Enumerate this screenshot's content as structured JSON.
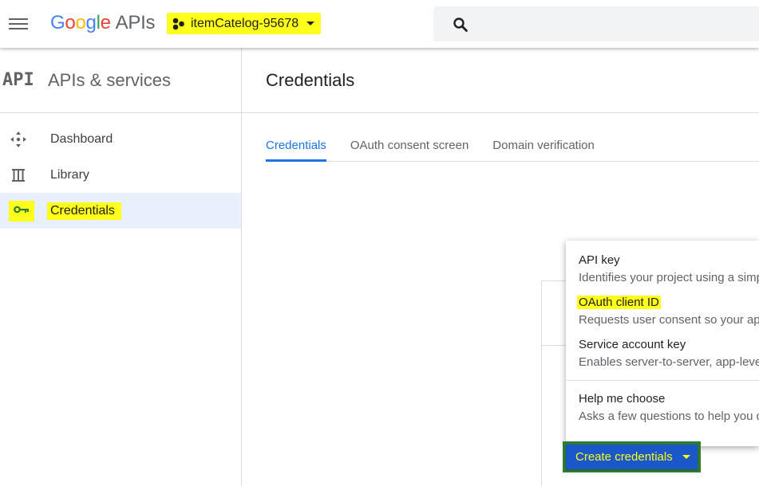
{
  "header": {
    "logo": {
      "G": "G",
      "o1": "o",
      "o2": "o",
      "g": "g",
      "l": "l",
      "e": "e",
      "apis": "APIs"
    },
    "project_name": "itemCatelog-95678"
  },
  "sidebar": {
    "badge": "API",
    "title": "APIs & services",
    "items": [
      {
        "label": "Dashboard",
        "icon": "dashboard-icon"
      },
      {
        "label": "Library",
        "icon": "library-icon"
      },
      {
        "label": "Credentials",
        "icon": "key-icon"
      }
    ]
  },
  "main": {
    "title": "Credentials",
    "tabs": [
      {
        "label": "Credentials"
      },
      {
        "label": "OAuth consent screen"
      },
      {
        "label": "Domain verification"
      }
    ]
  },
  "dropdown": {
    "items": [
      {
        "title": "API key",
        "desc": "Identifies your project using a simp"
      },
      {
        "title": "OAuth client ID",
        "desc": "Requests user consent so your ap"
      },
      {
        "title": "Service account key",
        "desc": "Enables server-to-server, app-level"
      },
      {
        "title": "Help me choose",
        "desc": "Asks a few questions to help you d"
      }
    ]
  },
  "create_button": {
    "label": "Create credentials"
  },
  "colors": {
    "highlight": "#ffff1c",
    "accent": "#1a73e8",
    "button": "#1a57c8"
  }
}
